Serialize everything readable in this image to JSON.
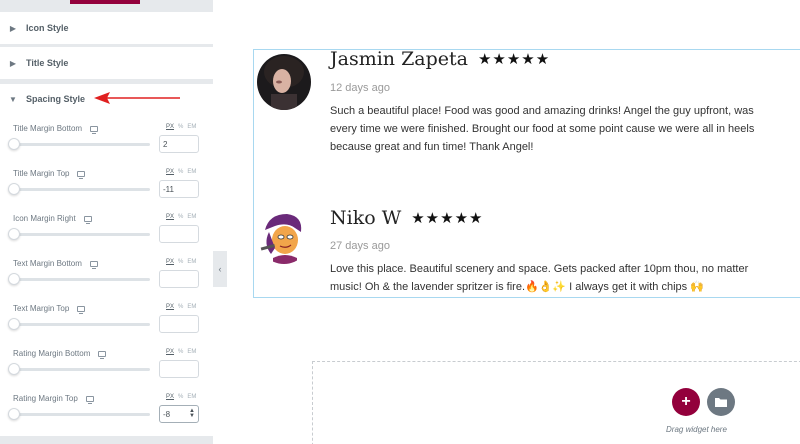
{
  "panel": {
    "sections": [
      {
        "label": "Icon Style"
      },
      {
        "label": "Title Style"
      },
      {
        "label": "Spacing Style"
      }
    ],
    "controls": [
      {
        "label": "Title Margin Bottom",
        "value": "2"
      },
      {
        "label": "Title Margin Top",
        "value": "-11"
      },
      {
        "label": "Icon Margin Right",
        "value": ""
      },
      {
        "label": "Text Margin Bottom",
        "value": ""
      },
      {
        "label": "Text Margin Top",
        "value": ""
      },
      {
        "label": "Rating Margin Bottom",
        "value": ""
      },
      {
        "label": "Rating Margin Top",
        "value": "-8"
      }
    ],
    "units": {
      "px": "PX",
      "percent": "%",
      "em": "EM"
    },
    "collapse_glyph": "‹"
  },
  "reviews": [
    {
      "name": "Jasmin Zapeta",
      "stars": "★★★★★",
      "ago": "12 days ago",
      "lines": [
        "Such a beautiful place! Food was good and amazing drinks! Angel the guy upfront, was",
        "every time we were finished. Brought our food at some point cause we were all in heels",
        "because great and fun time! Thank Angel!"
      ]
    },
    {
      "name": "Niko W",
      "stars": "★★★★★",
      "ago": "27 days ago",
      "lines": [
        "Love this place. Beautiful scenery and space. Gets packed after 10pm thou, no matter",
        "music! Oh & the lavender spritzer is fire.🔥👌✨ I always get it with chips 🙌"
      ]
    }
  ],
  "dropzone": {
    "add_glyph": "+",
    "hint": "Drag widget here"
  },
  "colors": {
    "accent": "#93003c",
    "arrow": "#e02020",
    "panel_bg": "#e6e9ec",
    "selection_border": "#a8d8f0"
  }
}
